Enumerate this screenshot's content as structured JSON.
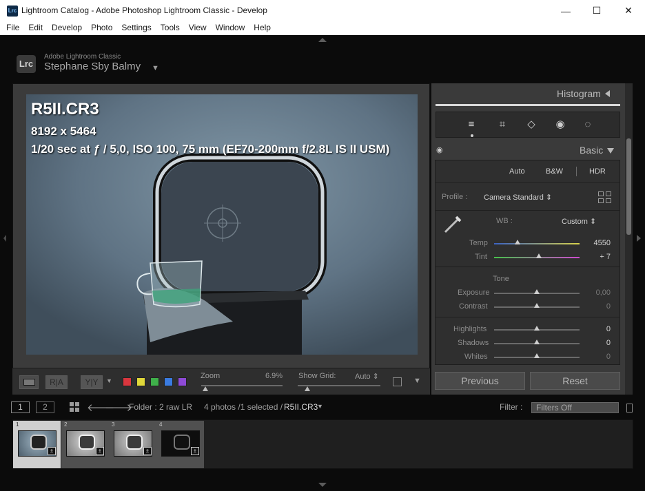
{
  "window": {
    "title": "Lightroom Catalog - Adobe Photoshop Lightroom Classic - Develop",
    "app_icon": "Lrc",
    "minimize": "—",
    "maximize": "☐",
    "close": "✕"
  },
  "menu": [
    "File",
    "Edit",
    "Develop",
    "Photo",
    "Settings",
    "Tools",
    "View",
    "Window",
    "Help"
  ],
  "identity": {
    "logo": "Lrc",
    "app_name": "Adobe Lightroom Classic",
    "user": "Stephane Sby Balmy",
    "caret": "▼"
  },
  "photo_overlay": {
    "filename": "R5II.CR3",
    "dimensions": "8192 x 5464",
    "exposure": "1/20 sec at ƒ / 5,0, ISO 100, 75 mm (EF70-200mm f/2.8L IS II USM)"
  },
  "toolbar": {
    "zoom_label": "Zoom",
    "zoom_value": "6.9%",
    "show_grid_label": "Show Grid:",
    "show_grid_value": "Auto ⇕",
    "ra_label": "R|A",
    "yy_label": "Y|Y",
    "swatches": [
      "#d9363e",
      "#e0d83a",
      "#3fb04a",
      "#3a7be0",
      "#8e4ad6"
    ]
  },
  "right_panel": {
    "histogram_label": "Histogram",
    "basic_label": "Basic",
    "tools": [
      "≡",
      "⌗",
      "◇",
      "◉",
      "◌"
    ],
    "treatment": [
      "Auto",
      "B&W",
      "HDR"
    ],
    "profile_label": "Profile :",
    "profile_value": "Camera Standard ⇕",
    "wb_label": "WB :",
    "wb_value": "Custom ⇕",
    "temp_label": "Temp",
    "temp_value": "4550",
    "tint_label": "Tint",
    "tint_value": "+ 7",
    "tone_label": "Tone",
    "exposure_label": "Exposure",
    "exposure_value": "0,00",
    "contrast_label": "Contrast",
    "contrast_value": "0",
    "highlights_label": "Highlights",
    "highlights_value": "0",
    "shadows_label": "Shadows",
    "shadows_value": "0",
    "whites_label": "Whites",
    "whites_value": "0",
    "previous_label": "Previous",
    "reset_label": "Reset"
  },
  "filmstrip_header": {
    "view1": "1",
    "view2": "2",
    "folder": "Folder : 2 raw LR",
    "count": "4 photos /1 selected /",
    "selected_file": "R5II.CR3",
    "filter_label": "Filter :",
    "filter_value": "Filters Off"
  },
  "thumbnails": [
    {
      "num": "1",
      "selected": true
    },
    {
      "num": "2",
      "selected": false
    },
    {
      "num": "3",
      "selected": false
    },
    {
      "num": "4",
      "selected": false
    }
  ]
}
